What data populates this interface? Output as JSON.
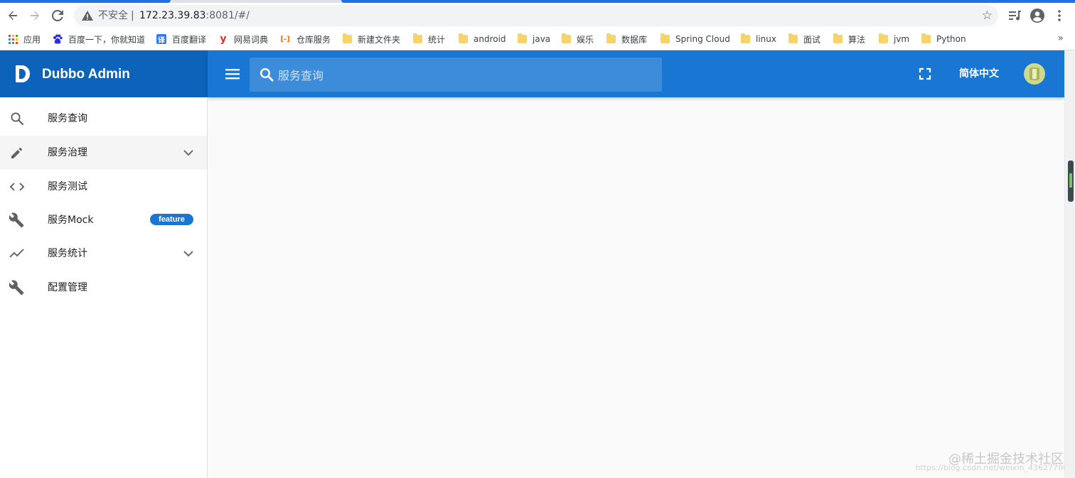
{
  "browser": {
    "security_label": "不安全",
    "url_host": "172.23.39.83",
    "url_rest": ":8081/#/",
    "bookmarks": [
      {
        "label": "应用",
        "icon": "apps-grid-icon"
      },
      {
        "label": "百度一下，你就知道",
        "icon": "baidu-icon"
      },
      {
        "label": "百度翻译",
        "icon": "translate-icon",
        "glyph": "译"
      },
      {
        "label": "网易词典",
        "icon": "youdao-icon",
        "glyph": "y"
      },
      {
        "label": "仓库服务",
        "icon": "repo-icon",
        "glyph": "[-]"
      },
      {
        "label": "新建文件夹",
        "icon": "folder-icon"
      },
      {
        "label": "统计",
        "icon": "folder-icon"
      },
      {
        "label": "android",
        "icon": "folder-icon"
      },
      {
        "label": "java",
        "icon": "folder-icon"
      },
      {
        "label": "娱乐",
        "icon": "folder-icon"
      },
      {
        "label": "数据库",
        "icon": "folder-icon"
      },
      {
        "label": "Spring Cloud",
        "icon": "folder-icon"
      },
      {
        "label": "linux",
        "icon": "folder-icon"
      },
      {
        "label": "面试",
        "icon": "folder-icon"
      },
      {
        "label": "算法",
        "icon": "folder-icon"
      },
      {
        "label": "jvm",
        "icon": "folder-icon"
      },
      {
        "label": "Python",
        "icon": "folder-icon"
      }
    ],
    "more": "»"
  },
  "app": {
    "brand_title": "Dubbo Admin",
    "search_placeholder": "服务查询",
    "language": "简体中文",
    "primary_color": "#1976d2",
    "brand_color": "#0d63b9"
  },
  "sidebar": {
    "items": [
      {
        "label": "服务查询",
        "icon": "search-icon"
      },
      {
        "label": "服务治理",
        "icon": "pencil-icon",
        "expandable": true,
        "active": true
      },
      {
        "label": "服务测试",
        "icon": "code-icon"
      },
      {
        "label": "服务Mock",
        "icon": "wrench-icon",
        "badge": "feature"
      },
      {
        "label": "服务统计",
        "icon": "trending-icon",
        "expandable": true
      },
      {
        "label": "配置管理",
        "icon": "wrench-icon"
      }
    ]
  },
  "watermark": {
    "text": "@稀土掘金技术社区",
    "sub": "https://blog.csdn.net/weixin_43627706"
  }
}
